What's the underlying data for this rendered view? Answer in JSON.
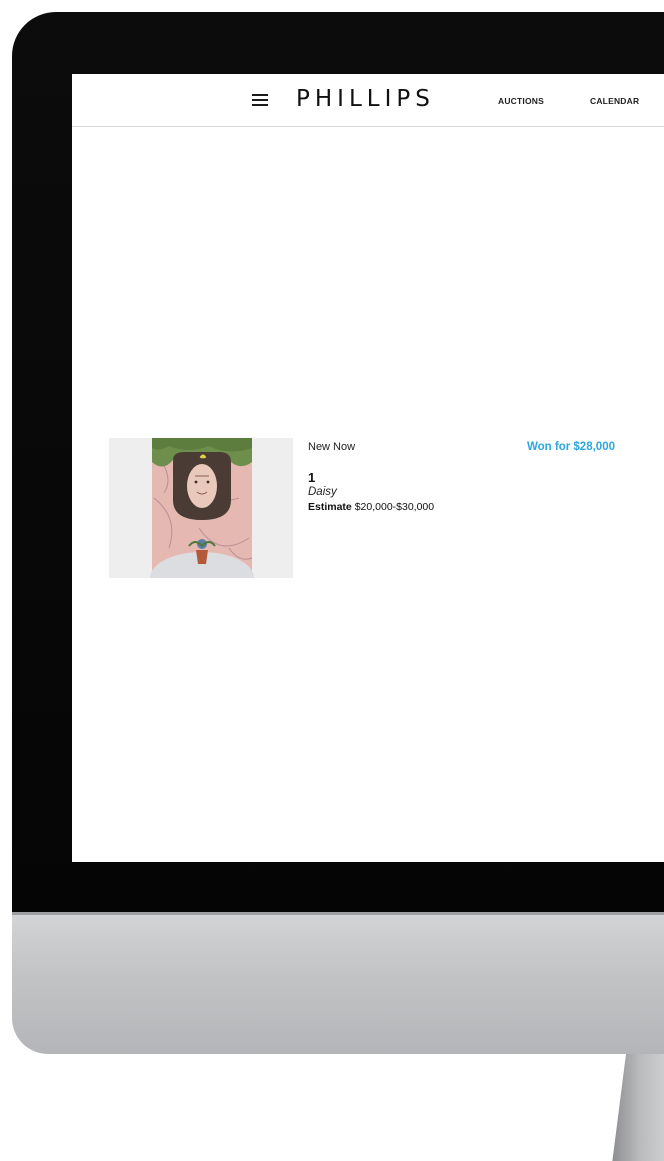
{
  "header": {
    "logo": "PHILLIPS",
    "nav": [
      {
        "label": "AUCTIONS"
      },
      {
        "label": "CALENDAR"
      }
    ],
    "menu_icon": "hamburger-menu-icon"
  },
  "lot": {
    "sale": "New Now",
    "number": "1",
    "title": "Daisy",
    "estimate_label": "Estimate",
    "estimate_value": "$20,000-$30,000",
    "result": "Won for $28,000",
    "result_color": "#2ba6e0"
  }
}
